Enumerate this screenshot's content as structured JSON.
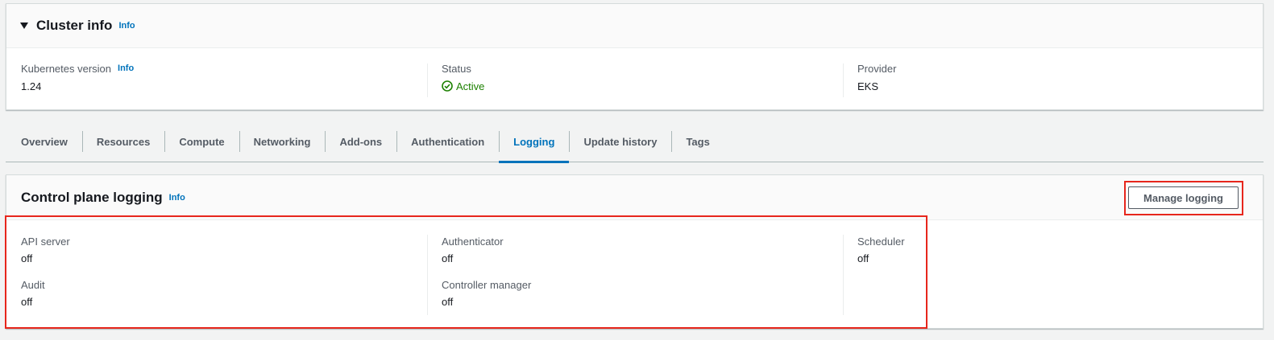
{
  "cluster_info": {
    "title": "Cluster info",
    "info_label": "Info",
    "fields": [
      {
        "label": "Kubernetes version",
        "info": "Info",
        "value": "1.24"
      },
      {
        "label": "Status",
        "value": "Active"
      },
      {
        "label": "Provider",
        "value": "EKS"
      }
    ]
  },
  "tabs": [
    {
      "label": "Overview"
    },
    {
      "label": "Resources"
    },
    {
      "label": "Compute"
    },
    {
      "label": "Networking"
    },
    {
      "label": "Add-ons"
    },
    {
      "label": "Authentication"
    },
    {
      "label": "Logging",
      "active": true
    },
    {
      "label": "Update history"
    },
    {
      "label": "Tags"
    }
  ],
  "logging": {
    "title": "Control plane logging",
    "info_label": "Info",
    "manage_button": "Manage logging",
    "columns": [
      [
        {
          "label": "API server",
          "value": "off"
        },
        {
          "label": "Audit",
          "value": "off"
        }
      ],
      [
        {
          "label": "Authenticator",
          "value": "off"
        },
        {
          "label": "Controller manager",
          "value": "off"
        }
      ],
      [
        {
          "label": "Scheduler",
          "value": "off"
        }
      ]
    ]
  },
  "colors": {
    "accent": "#0073bb",
    "status_active": "#1d8102",
    "highlight": "#e7261c"
  }
}
